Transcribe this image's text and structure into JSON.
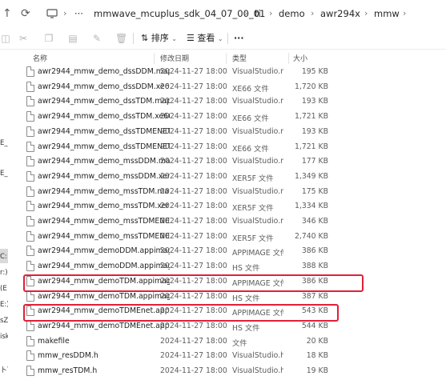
{
  "address_bar": {
    "nav_icons": [
      "up-arrow-icon",
      "refresh-icon",
      "monitor-icon"
    ],
    "more_label": "···",
    "crumbs": [
      "mmwave_mcuplus_sdk_04_07_00_01",
      "ti",
      "demo",
      "awr294x",
      "mmw"
    ]
  },
  "toolbar": {
    "sort_label": "排序",
    "view_label": "查看",
    "more_label": "···"
  },
  "sidebar": {
    "fragments": [
      "E_F",
      "E_N",
      "C:",
      "r:)",
      "(E",
      "E:)",
      "sZe",
      "isk",
      "卜丁"
    ]
  },
  "columns": {
    "name": "名称",
    "date": "修改日期",
    "type": "类型",
    "size": "大小"
  },
  "files": [
    {
      "name": "awr2944_mmw_demo_dssDDM.map",
      "date": "2024-11-27 18:00",
      "type": "VisualStudio.ma...",
      "size": "195 KB"
    },
    {
      "name": "awr2944_mmw_demo_dssDDM.xe66",
      "date": "2024-11-27 18:00",
      "type": "XE66 文件",
      "size": "1,720 KB"
    },
    {
      "name": "awr2944_mmw_demo_dssTDM.map",
      "date": "2024-11-27 18:00",
      "type": "VisualStudio.ma...",
      "size": "193 KB"
    },
    {
      "name": "awr2944_mmw_demo_dssTDM.xe66",
      "date": "2024-11-27 18:00",
      "type": "XE66 文件",
      "size": "1,721 KB"
    },
    {
      "name": "awr2944_mmw_demo_dssTDMENET....",
      "date": "2024-11-27 18:00",
      "type": "VisualStudio.ma...",
      "size": "193 KB"
    },
    {
      "name": "awr2944_mmw_demo_dssTDMENET....",
      "date": "2024-11-27 18:00",
      "type": "XE66 文件",
      "size": "1,721 KB"
    },
    {
      "name": "awr2944_mmw_demo_mssDDM.map",
      "date": "2024-11-27 18:00",
      "type": "VisualStudio.ma...",
      "size": "177 KB"
    },
    {
      "name": "awr2944_mmw_demo_mssDDM.xer5f",
      "date": "2024-11-27 18:00",
      "type": "XER5F 文件",
      "size": "1,349 KB"
    },
    {
      "name": "awr2944_mmw_demo_mssTDM.map",
      "date": "2024-11-27 18:00",
      "type": "VisualStudio.ma...",
      "size": "175 KB"
    },
    {
      "name": "awr2944_mmw_demo_mssTDM.xer5f",
      "date": "2024-11-27 18:00",
      "type": "XER5F 文件",
      "size": "1,334 KB"
    },
    {
      "name": "awr2944_mmw_demo_mssTDMENET....",
      "date": "2024-11-27 18:00",
      "type": "VisualStudio.ma...",
      "size": "346 KB"
    },
    {
      "name": "awr2944_mmw_demo_mssTDMENET....",
      "date": "2024-11-27 18:00",
      "type": "XER5F 文件",
      "size": "2,740 KB"
    },
    {
      "name": "awr2944_mmw_demoDDM.appimage",
      "date": "2024-11-27 18:00",
      "type": "APPIMAGE 文件",
      "size": "386 KB"
    },
    {
      "name": "awr2944_mmw_demoDDM.appimag...",
      "date": "2024-11-27 18:00",
      "type": "HS 文件",
      "size": "388 KB"
    },
    {
      "name": "awr2944_mmw_demoTDM.appimage",
      "date": "2024-11-27 18:00",
      "type": "APPIMAGE 文件",
      "size": "386 KB"
    },
    {
      "name": "awr2944_mmw_demoTDM.appimag...",
      "date": "2024-11-27 18:00",
      "type": "HS 文件",
      "size": "387 KB"
    },
    {
      "name": "awr2944_mmw_demoTDMEnet.appi...",
      "date": "2024-11-27 18:00",
      "type": "APPIMAGE 文件",
      "size": "543 KB"
    },
    {
      "name": "awr2944_mmw_demoTDMEnet.appi...",
      "date": "2024-11-27 18:00",
      "type": "HS 文件",
      "size": "544 KB"
    },
    {
      "name": "makefile",
      "date": "2024-11-27 18:00",
      "type": "文件",
      "size": "20 KB"
    },
    {
      "name": "mmw_resDDM.h",
      "date": "2024-11-27 18:00",
      "type": "VisualStudio.h.1...",
      "size": "18 KB"
    },
    {
      "name": "mmw_resTDM.h",
      "date": "2024-11-27 18:00",
      "type": "VisualStudio.h.1...",
      "size": "19 KB"
    }
  ],
  "highlight_color": "#e0203a"
}
